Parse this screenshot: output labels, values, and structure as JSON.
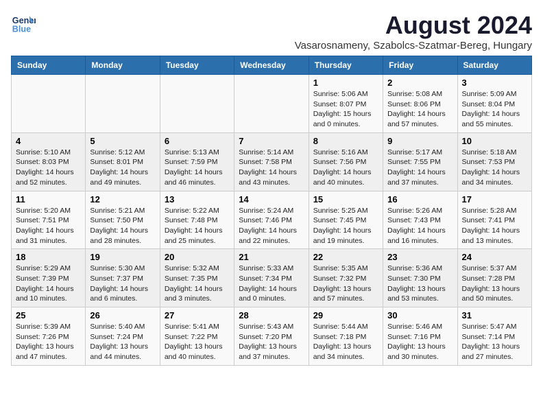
{
  "header": {
    "logo_line1": "General",
    "logo_line2": "Blue",
    "month_title": "August 2024",
    "subtitle": "Vasarosnameny, Szabolcs-Szatmar-Bereg, Hungary"
  },
  "weekdays": [
    "Sunday",
    "Monday",
    "Tuesday",
    "Wednesday",
    "Thursday",
    "Friday",
    "Saturday"
  ],
  "weeks": [
    [
      {
        "day": "",
        "info": ""
      },
      {
        "day": "",
        "info": ""
      },
      {
        "day": "",
        "info": ""
      },
      {
        "day": "",
        "info": ""
      },
      {
        "day": "1",
        "info": "Sunrise: 5:06 AM\nSunset: 8:07 PM\nDaylight: 15 hours\nand 0 minutes."
      },
      {
        "day": "2",
        "info": "Sunrise: 5:08 AM\nSunset: 8:06 PM\nDaylight: 14 hours\nand 57 minutes."
      },
      {
        "day": "3",
        "info": "Sunrise: 5:09 AM\nSunset: 8:04 PM\nDaylight: 14 hours\nand 55 minutes."
      }
    ],
    [
      {
        "day": "4",
        "info": "Sunrise: 5:10 AM\nSunset: 8:03 PM\nDaylight: 14 hours\nand 52 minutes."
      },
      {
        "day": "5",
        "info": "Sunrise: 5:12 AM\nSunset: 8:01 PM\nDaylight: 14 hours\nand 49 minutes."
      },
      {
        "day": "6",
        "info": "Sunrise: 5:13 AM\nSunset: 7:59 PM\nDaylight: 14 hours\nand 46 minutes."
      },
      {
        "day": "7",
        "info": "Sunrise: 5:14 AM\nSunset: 7:58 PM\nDaylight: 14 hours\nand 43 minutes."
      },
      {
        "day": "8",
        "info": "Sunrise: 5:16 AM\nSunset: 7:56 PM\nDaylight: 14 hours\nand 40 minutes."
      },
      {
        "day": "9",
        "info": "Sunrise: 5:17 AM\nSunset: 7:55 PM\nDaylight: 14 hours\nand 37 minutes."
      },
      {
        "day": "10",
        "info": "Sunrise: 5:18 AM\nSunset: 7:53 PM\nDaylight: 14 hours\nand 34 minutes."
      }
    ],
    [
      {
        "day": "11",
        "info": "Sunrise: 5:20 AM\nSunset: 7:51 PM\nDaylight: 14 hours\nand 31 minutes."
      },
      {
        "day": "12",
        "info": "Sunrise: 5:21 AM\nSunset: 7:50 PM\nDaylight: 14 hours\nand 28 minutes."
      },
      {
        "day": "13",
        "info": "Sunrise: 5:22 AM\nSunset: 7:48 PM\nDaylight: 14 hours\nand 25 minutes."
      },
      {
        "day": "14",
        "info": "Sunrise: 5:24 AM\nSunset: 7:46 PM\nDaylight: 14 hours\nand 22 minutes."
      },
      {
        "day": "15",
        "info": "Sunrise: 5:25 AM\nSunset: 7:45 PM\nDaylight: 14 hours\nand 19 minutes."
      },
      {
        "day": "16",
        "info": "Sunrise: 5:26 AM\nSunset: 7:43 PM\nDaylight: 14 hours\nand 16 minutes."
      },
      {
        "day": "17",
        "info": "Sunrise: 5:28 AM\nSunset: 7:41 PM\nDaylight: 14 hours\nand 13 minutes."
      }
    ],
    [
      {
        "day": "18",
        "info": "Sunrise: 5:29 AM\nSunset: 7:39 PM\nDaylight: 14 hours\nand 10 minutes."
      },
      {
        "day": "19",
        "info": "Sunrise: 5:30 AM\nSunset: 7:37 PM\nDaylight: 14 hours\nand 6 minutes."
      },
      {
        "day": "20",
        "info": "Sunrise: 5:32 AM\nSunset: 7:35 PM\nDaylight: 14 hours\nand 3 minutes."
      },
      {
        "day": "21",
        "info": "Sunrise: 5:33 AM\nSunset: 7:34 PM\nDaylight: 14 hours\nand 0 minutes."
      },
      {
        "day": "22",
        "info": "Sunrise: 5:35 AM\nSunset: 7:32 PM\nDaylight: 13 hours\nand 57 minutes."
      },
      {
        "day": "23",
        "info": "Sunrise: 5:36 AM\nSunset: 7:30 PM\nDaylight: 13 hours\nand 53 minutes."
      },
      {
        "day": "24",
        "info": "Sunrise: 5:37 AM\nSunset: 7:28 PM\nDaylight: 13 hours\nand 50 minutes."
      }
    ],
    [
      {
        "day": "25",
        "info": "Sunrise: 5:39 AM\nSunset: 7:26 PM\nDaylight: 13 hours\nand 47 minutes."
      },
      {
        "day": "26",
        "info": "Sunrise: 5:40 AM\nSunset: 7:24 PM\nDaylight: 13 hours\nand 44 minutes."
      },
      {
        "day": "27",
        "info": "Sunrise: 5:41 AM\nSunset: 7:22 PM\nDaylight: 13 hours\nand 40 minutes."
      },
      {
        "day": "28",
        "info": "Sunrise: 5:43 AM\nSunset: 7:20 PM\nDaylight: 13 hours\nand 37 minutes."
      },
      {
        "day": "29",
        "info": "Sunrise: 5:44 AM\nSunset: 7:18 PM\nDaylight: 13 hours\nand 34 minutes."
      },
      {
        "day": "30",
        "info": "Sunrise: 5:46 AM\nSunset: 7:16 PM\nDaylight: 13 hours\nand 30 minutes."
      },
      {
        "day": "31",
        "info": "Sunrise: 5:47 AM\nSunset: 7:14 PM\nDaylight: 13 hours\nand 27 minutes."
      }
    ]
  ]
}
